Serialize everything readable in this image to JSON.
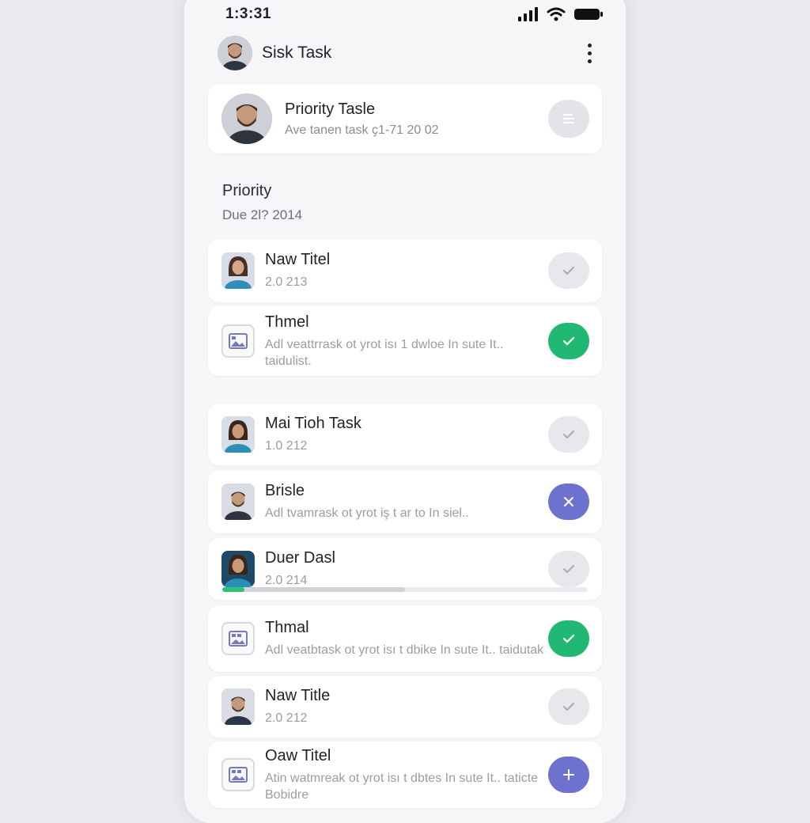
{
  "status": {
    "time": "1:3:31"
  },
  "header": {
    "title": "Sisk Task"
  },
  "featured": {
    "title": "Priority Tasle",
    "subtitle": "Ave tanen task ҫ1-71 20 02"
  },
  "section": {
    "title": "Priority",
    "subtitle": "Due 2l? 2014"
  },
  "tasks": [
    {
      "title": "Naw Titel",
      "subtitle": "2.0 213",
      "thumb": "person-female-icon",
      "action": "check-icon",
      "action_state": "neutral"
    },
    {
      "title": "Thmel",
      "subtitle": "Adl veattrrask ot yrot isı 1 dwloe In sute It.. taidulist.",
      "thumb": "image-icon",
      "action": "check-icon",
      "action_state": "done"
    },
    {
      "title": "Mai Tioh Task",
      "subtitle": "1.0 212",
      "thumb": "person-female-icon",
      "action": "check-icon",
      "action_state": "neutral"
    },
    {
      "title": "Brisle",
      "subtitle": "Adl tvamrask ot yrot iş t ar to In siel..",
      "thumb": "person-male-icon",
      "action": "close-icon",
      "action_state": "purple"
    },
    {
      "title": "Duer Dasl",
      "subtitle": "2.0 214",
      "thumb": "person-female-icon",
      "action": "check-icon",
      "action_state": "neutral",
      "progress": 0.06,
      "progress_secondary": 0.5
    },
    {
      "title": "Thmal",
      "subtitle": "Adl veatbtask ot yrot isı t dbike In sute It.. taidutak",
      "thumb": "image-icon",
      "action": "check-icon",
      "action_state": "done"
    },
    {
      "title": "Naw Title",
      "subtitle": "2.0 212",
      "thumb": "person-male-icon",
      "action": "check-icon",
      "action_state": "neutral"
    },
    {
      "title": "Oaw Titel",
      "subtitle": "Atin watmreak ot yrot isı t dbtes In sute It.. taticte Bobidre",
      "thumb": "image-icon",
      "action": "plus-icon",
      "action_state": "purple"
    }
  ],
  "colors": {
    "accent_green": "#21b874",
    "accent_purple": "#6e72cf",
    "neutral": "#e7e8ec"
  }
}
